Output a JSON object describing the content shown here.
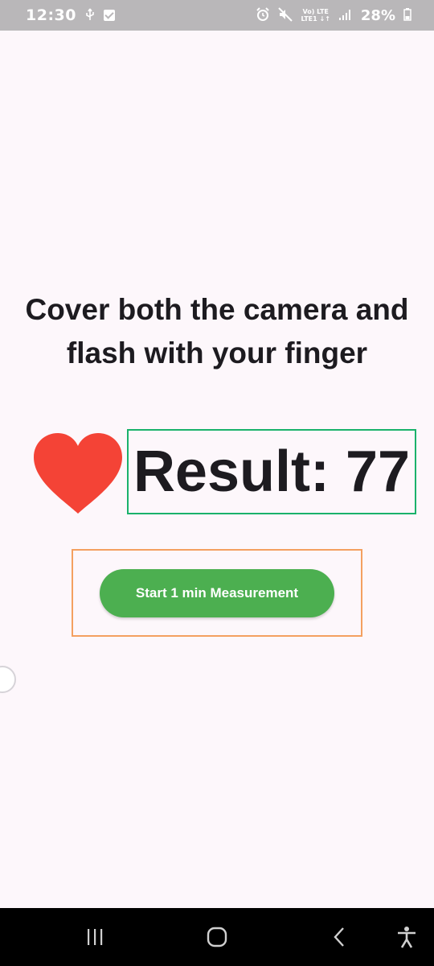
{
  "status_bar": {
    "time": "12:30",
    "lte_top": "Vo) LTE",
    "lte_bottom": "LTE1 ↓↑",
    "battery": "28%",
    "icons": [
      "usb-icon",
      "check-icon",
      "alarm-icon",
      "mute-icon",
      "signal-icon",
      "battery-icon"
    ]
  },
  "main": {
    "instruction": "Cover both the camera and flash with your finger",
    "result": "Result: 77",
    "start_button_label": "Start 1 min Measurement"
  },
  "colors": {
    "heart": "#f44336",
    "button": "#4caf50",
    "result_frame": "#1ab26b",
    "button_frame": "#f4a060",
    "background": "#fdf7fb"
  },
  "nav_bar": {
    "icons": [
      "recent-apps-icon",
      "home-icon",
      "back-icon",
      "accessibility-icon"
    ]
  }
}
